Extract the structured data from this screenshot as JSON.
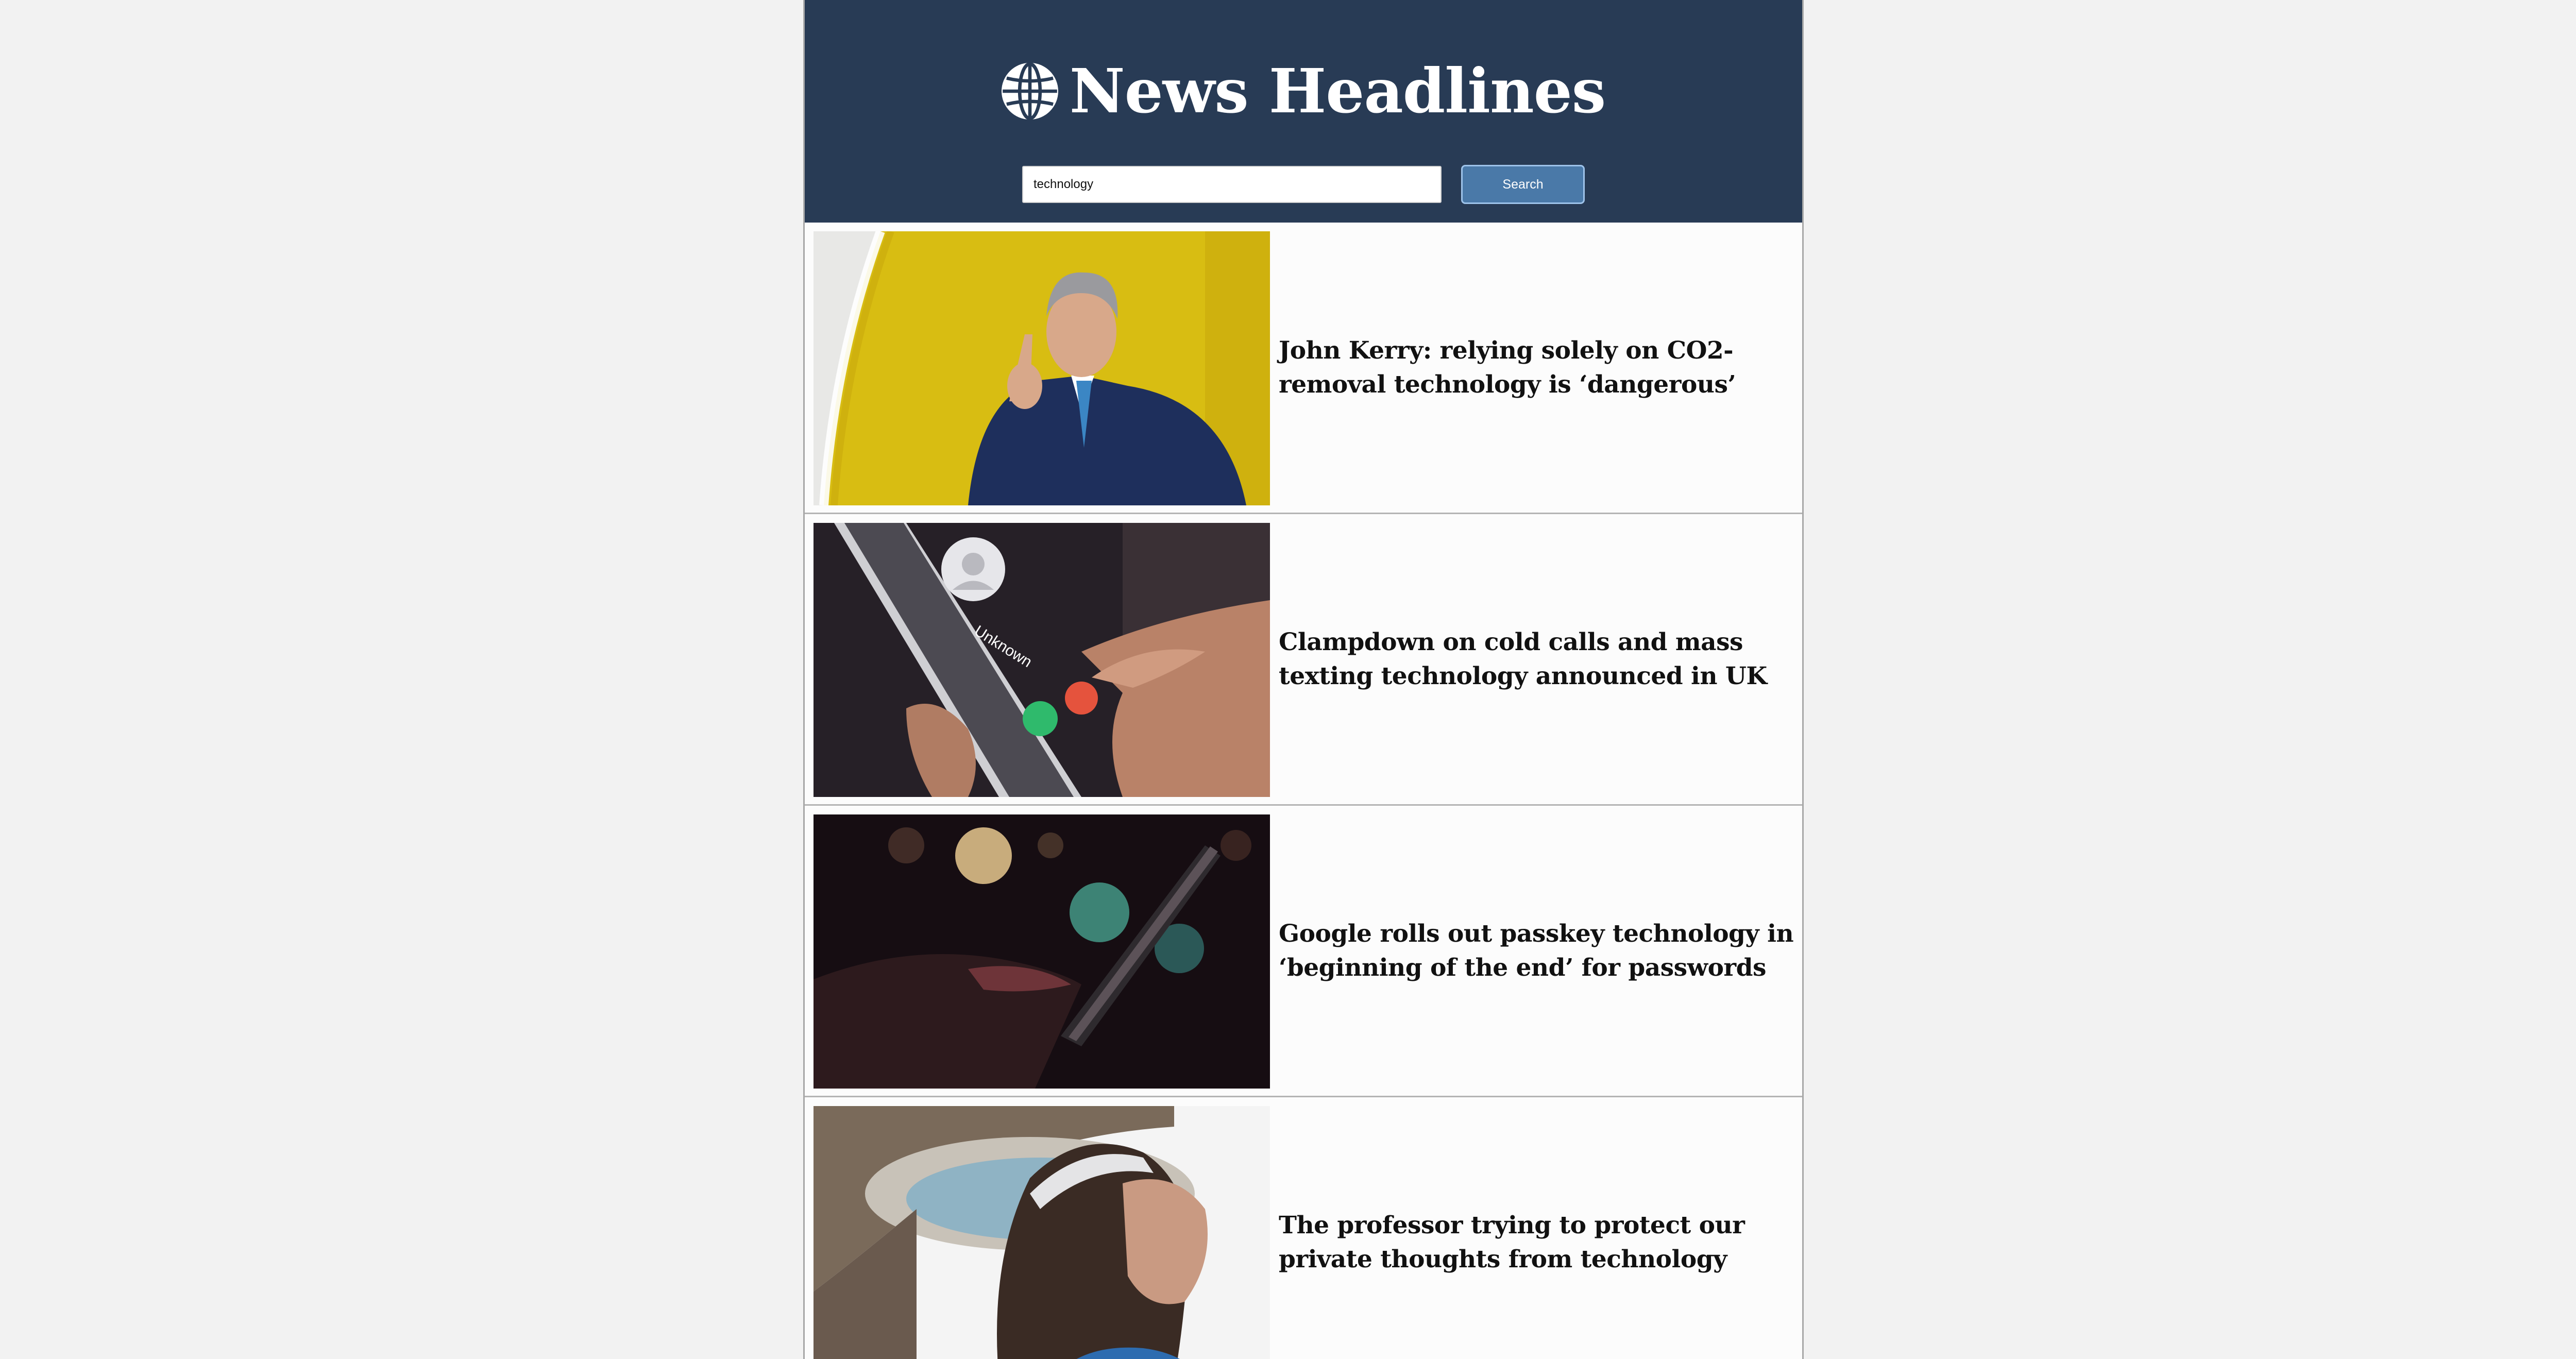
{
  "header": {
    "title": "News Headlines",
    "logo_icon": "globe-icon"
  },
  "search": {
    "value": "technology",
    "placeholder": "",
    "button_label": "Search"
  },
  "articles": [
    {
      "headline": "John Kerry: relying solely on CO2-removal technology is ‘dangerous’"
    },
    {
      "headline": "Clampdown on cold calls and mass texting technology announced in UK"
    },
    {
      "headline": "Google rolls out passkey technology in ‘beginning of the end’ for passwords"
    },
    {
      "headline": "The professor trying to protect our private thoughts from technology"
    }
  ],
  "colors": {
    "header_bg": "#283b55",
    "button_bg": "#4a79a8",
    "page_bg": "#f2f2f2"
  }
}
